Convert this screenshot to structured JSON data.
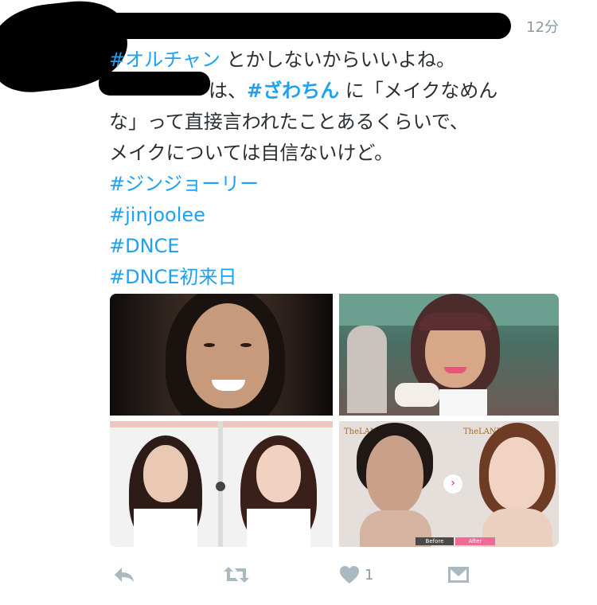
{
  "tweet": {
    "timestamp": "12分",
    "lines": {
      "l1_tag": "#オルチャン",
      "l1_text": " とかしないからいいよね。",
      "l2_text_a": "は、",
      "l2_tag": "#ざわちん",
      "l2_text_b": " に「メイクなめん",
      "l3": "な」って直接言われたことあるくらいで、",
      "l4": "メイクについては自信ないけど。",
      "l5": "#ジンジョーリー",
      "l6": "#jinjoolee",
      "l7": "#DNCE",
      "l8": "#DNCE初来日"
    }
  },
  "media": {
    "brand_left": "TheLANE",
    "brand_right": "TheLANE",
    "before_label": "Before",
    "after_label": "After"
  },
  "actions": {
    "like_count": "1"
  },
  "colors": {
    "hashtag": "#1da1f2",
    "icon": "#aab8c2",
    "timestamp": "#8899a6"
  }
}
